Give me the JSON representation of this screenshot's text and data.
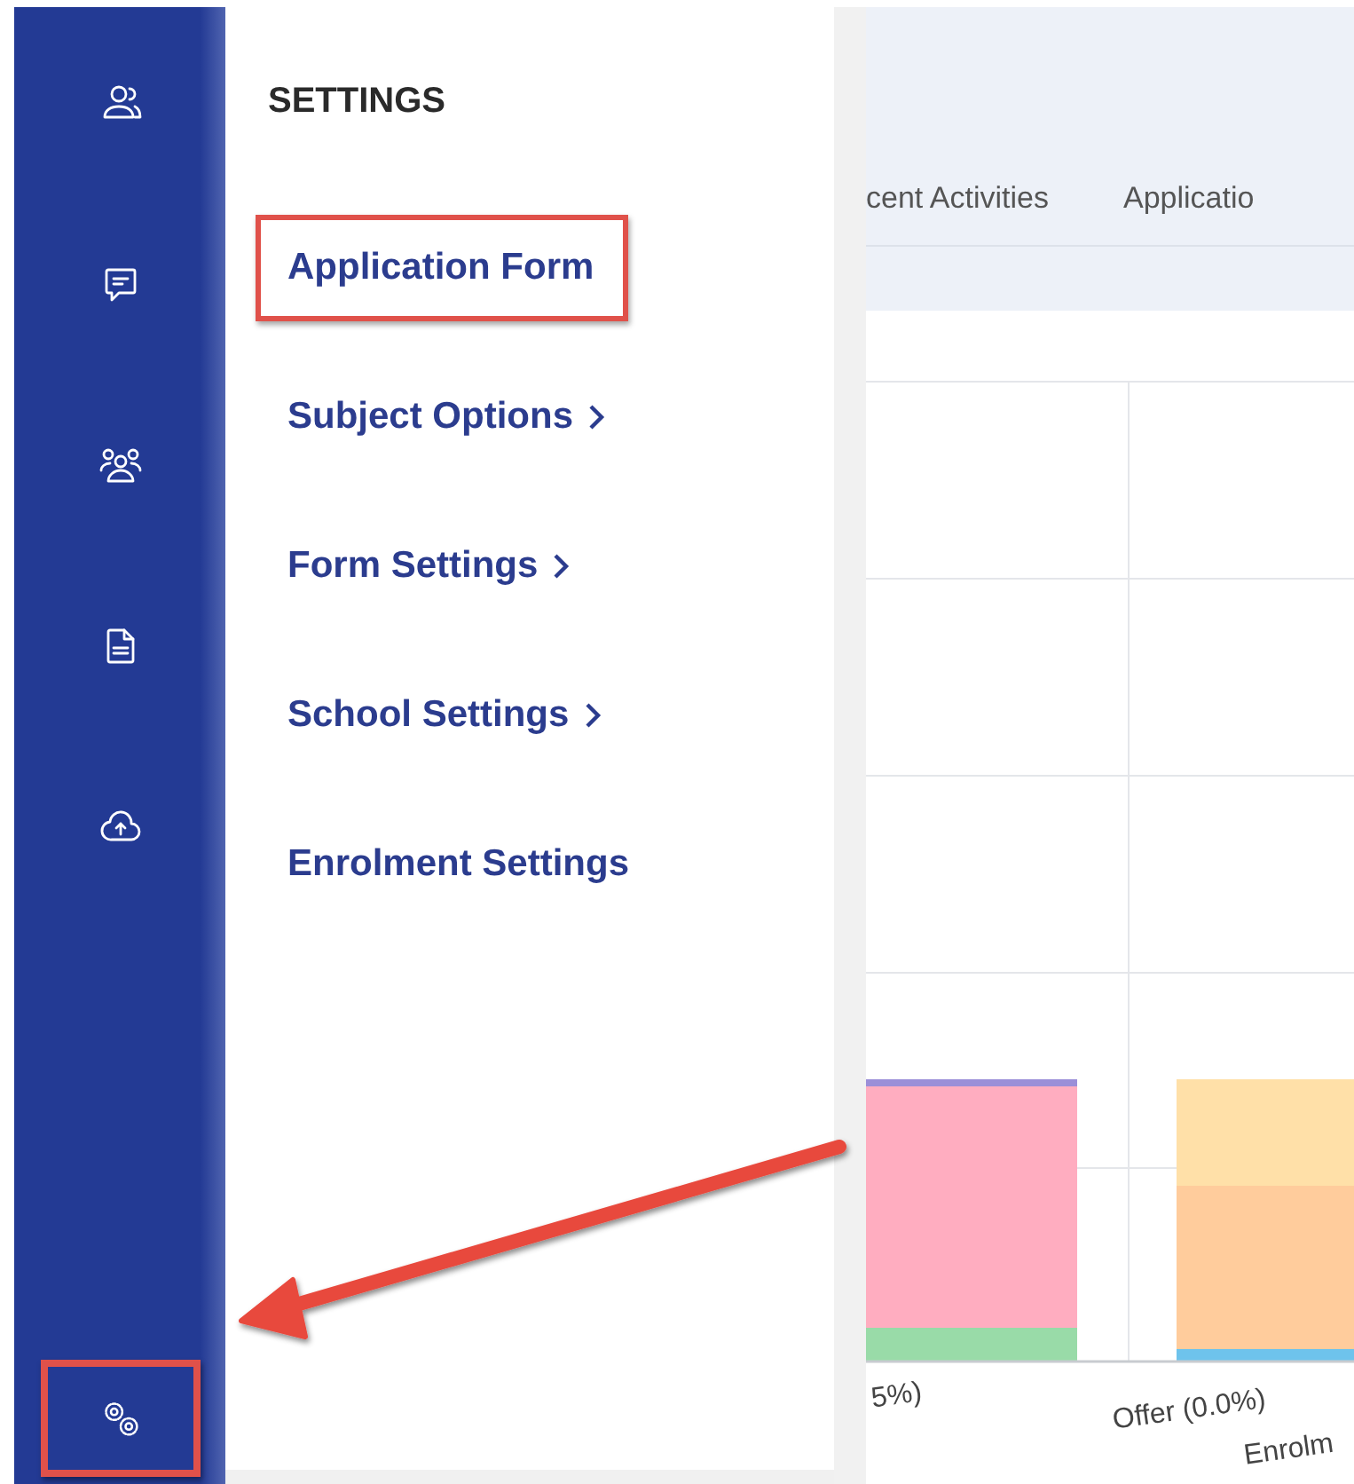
{
  "sidebar": {
    "items": [
      {
        "kind": "people",
        "annotated": false
      },
      {
        "kind": "message",
        "annotated": false
      },
      {
        "kind": "group",
        "annotated": false
      },
      {
        "kind": "document",
        "annotated": false
      },
      {
        "kind": "upload",
        "annotated": false
      },
      {
        "kind": "settings",
        "annotated": true
      }
    ]
  },
  "settings_panel": {
    "title": "SETTINGS",
    "items": [
      {
        "label": "Application Form",
        "submenu": false,
        "annotated": true
      },
      {
        "label": "Subject Options",
        "submenu": true,
        "annotated": false
      },
      {
        "label": "Form Settings",
        "submenu": true,
        "annotated": false
      },
      {
        "label": "School Settings",
        "submenu": true,
        "annotated": false
      },
      {
        "label": "Enrolment Settings",
        "submenu": false,
        "annotated": false
      }
    ]
  },
  "background_app": {
    "tabs": [
      "cent Activities",
      "Applicatio"
    ],
    "chart_labels": [
      "5%)",
      "Offer (0.0%)",
      "Enrolm"
    ]
  },
  "annotation": {
    "arrow": true
  }
}
